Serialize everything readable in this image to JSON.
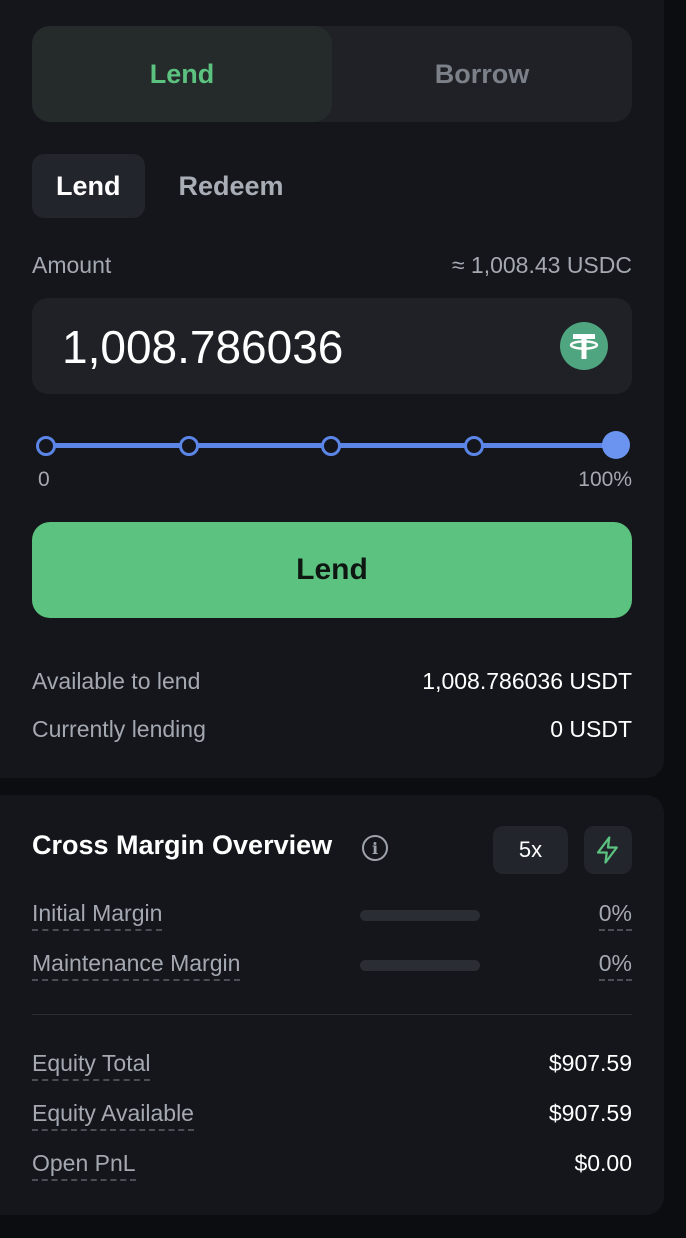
{
  "mode_toggle": {
    "lend_label": "Lend",
    "borrow_label": "Borrow"
  },
  "sub_tabs": {
    "lend_label": "Lend",
    "redeem_label": "Redeem"
  },
  "amount": {
    "label": "Amount",
    "conversion": "≈ 1,008.43 USDC",
    "value": "1,008.786036",
    "token_icon": "tether-icon"
  },
  "slider": {
    "min_label": "0",
    "max_label": "100%",
    "value_percent": 100
  },
  "lend_button_label": "Lend",
  "info": {
    "available_label": "Available to lend",
    "available_value": "1,008.786036 USDT",
    "lending_label": "Currently lending",
    "lending_value": "0 USDT"
  },
  "overview": {
    "title": "Cross Margin Overview",
    "leverage": "5x",
    "initial_margin_label": "Initial Margin",
    "initial_margin_value": "0%",
    "initial_margin_level": 0,
    "maintenance_margin_label": "Maintenance Margin",
    "maintenance_margin_value": "0%",
    "maintenance_margin_level": 0,
    "equity_total_label": "Equity Total",
    "equity_total_value": "$907.59",
    "equity_available_label": "Equity Available",
    "equity_available_value": "$907.59",
    "open_pnl_label": "Open PnL",
    "open_pnl_value": "$0.00"
  },
  "colors": {
    "accent_green": "#5bc27f",
    "slider_blue": "#5b86e8",
    "panel_bg": "#14161b"
  }
}
